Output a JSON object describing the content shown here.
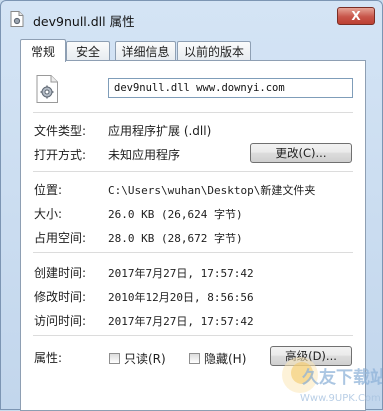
{
  "window": {
    "title": "dev9null.dll 属性",
    "close_glyph": "X"
  },
  "tabs": [
    {
      "label": "常规",
      "active": true
    },
    {
      "label": "安全",
      "active": false
    },
    {
      "label": "详细信息",
      "active": false
    },
    {
      "label": "以前的版本",
      "active": false
    }
  ],
  "file": {
    "name": "dev9null.dll www.downyi.com"
  },
  "props": {
    "type_label": "文件类型:",
    "type_value": "应用程序扩展 (.dll)",
    "open_label": "打开方式:",
    "open_value": "未知应用程序",
    "change_button": "更改(C)...",
    "location_label": "位置:",
    "location_value": "C:\\Users\\wuhan\\Desktop\\新建文件夹",
    "size_label": "大小:",
    "size_value": "26.0 KB (26,624 字节)",
    "disk_label": "占用空间:",
    "disk_value": "28.0 KB (28,672 字节)",
    "created_label": "创建时间:",
    "created_value": "2017年7月27日, 17:57:42",
    "modified_label": "修改时间:",
    "modified_value": "2010年12月20日, 8:56:56",
    "accessed_label": "访问时间:",
    "accessed_value": "2017年7月27日, 17:57:42",
    "attr_label": "属性:",
    "readonly_label": "只读(R)",
    "hidden_label": "隐藏(H)",
    "advanced_button": "高级(D)..."
  },
  "watermark": {
    "text": "久友下载站",
    "url": "Www.9UPK.Com"
  }
}
